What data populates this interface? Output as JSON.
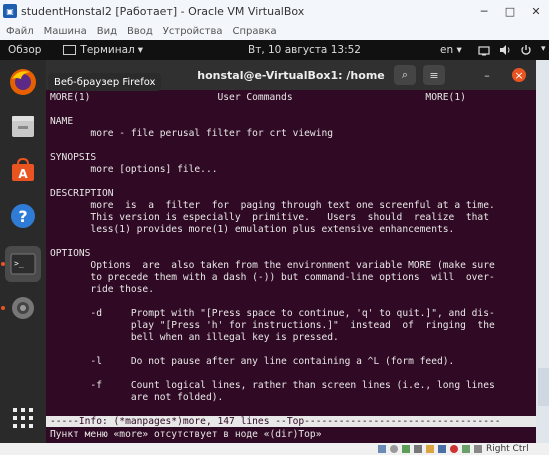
{
  "vbox": {
    "title": "studentHonstal2 [Работает] - Oracle VM VirtualBox",
    "minimize": "─",
    "maximize": "□",
    "close": "✕",
    "menu": [
      "Файл",
      "Машина",
      "Вид",
      "Ввод",
      "Устройства",
      "Справка"
    ],
    "host_key": "Right Ctrl"
  },
  "gnome": {
    "overview": "Обзор",
    "app_menu": "Терминал",
    "app_menu_arrow": "▾",
    "clock": "Вт, 10 августа  13:52",
    "lang": "en",
    "lang_arrow": "▾"
  },
  "dock": {
    "tooltip": "Веб-браузер Firefox",
    "items": [
      {
        "icon": "firefox-icon"
      },
      {
        "icon": "files-icon"
      },
      {
        "icon": "software-icon"
      },
      {
        "icon": "help-icon"
      },
      {
        "icon": "terminal-icon"
      },
      {
        "icon": "settings-icon"
      },
      {
        "icon": "app-grid-icon"
      }
    ]
  },
  "terminal": {
    "title": "honstal@e-VirtualBox1: /home",
    "search_glyph": "⌕",
    "menu_glyph": "≡",
    "minimize_glyph": "–",
    "close_glyph": "×",
    "lines": [
      "MORE(1)                      User Commands                       MORE(1)",
      "",
      "NAME",
      "       more - file perusal filter for crt viewing",
      "",
      "SYNOPSIS",
      "       more [options] file...",
      "",
      "DESCRIPTION",
      "       more  is  a  filter  for  paging through text one screenful at a time.",
      "       This version is especially  primitive.   Users  should  realize  that",
      "       less(1) provides more(1) emulation plus extensive enhancements.",
      "",
      "OPTIONS",
      "       Options  are  also taken from the environment variable MORE (make sure",
      "       to precede them with a dash (-)) but command-line options  will  over-",
      "       ride those.",
      "",
      "       -d     Prompt with \"[Press space to continue, 'q' to quit.]\", and dis-",
      "              play \"[Press 'h' for instructions.]\"  instead  of  ringing  the",
      "              bell when an illegal key is pressed.",
      "",
      "       -l     Do not pause after any line containing a ^L (form feed).",
      "",
      "       -f     Count logical lines, rather than screen lines (i.e., long lines",
      "              are not folded)."
    ],
    "status_line": "-----Info: (*manpages*)more, 147 lines --Top----------------------------------",
    "echo_line": "Пункт меню «more» отсутствует в ноде «(dir)Top»"
  },
  "colors": {
    "terminal_bg": "#300a24",
    "accent": "#e95420"
  }
}
